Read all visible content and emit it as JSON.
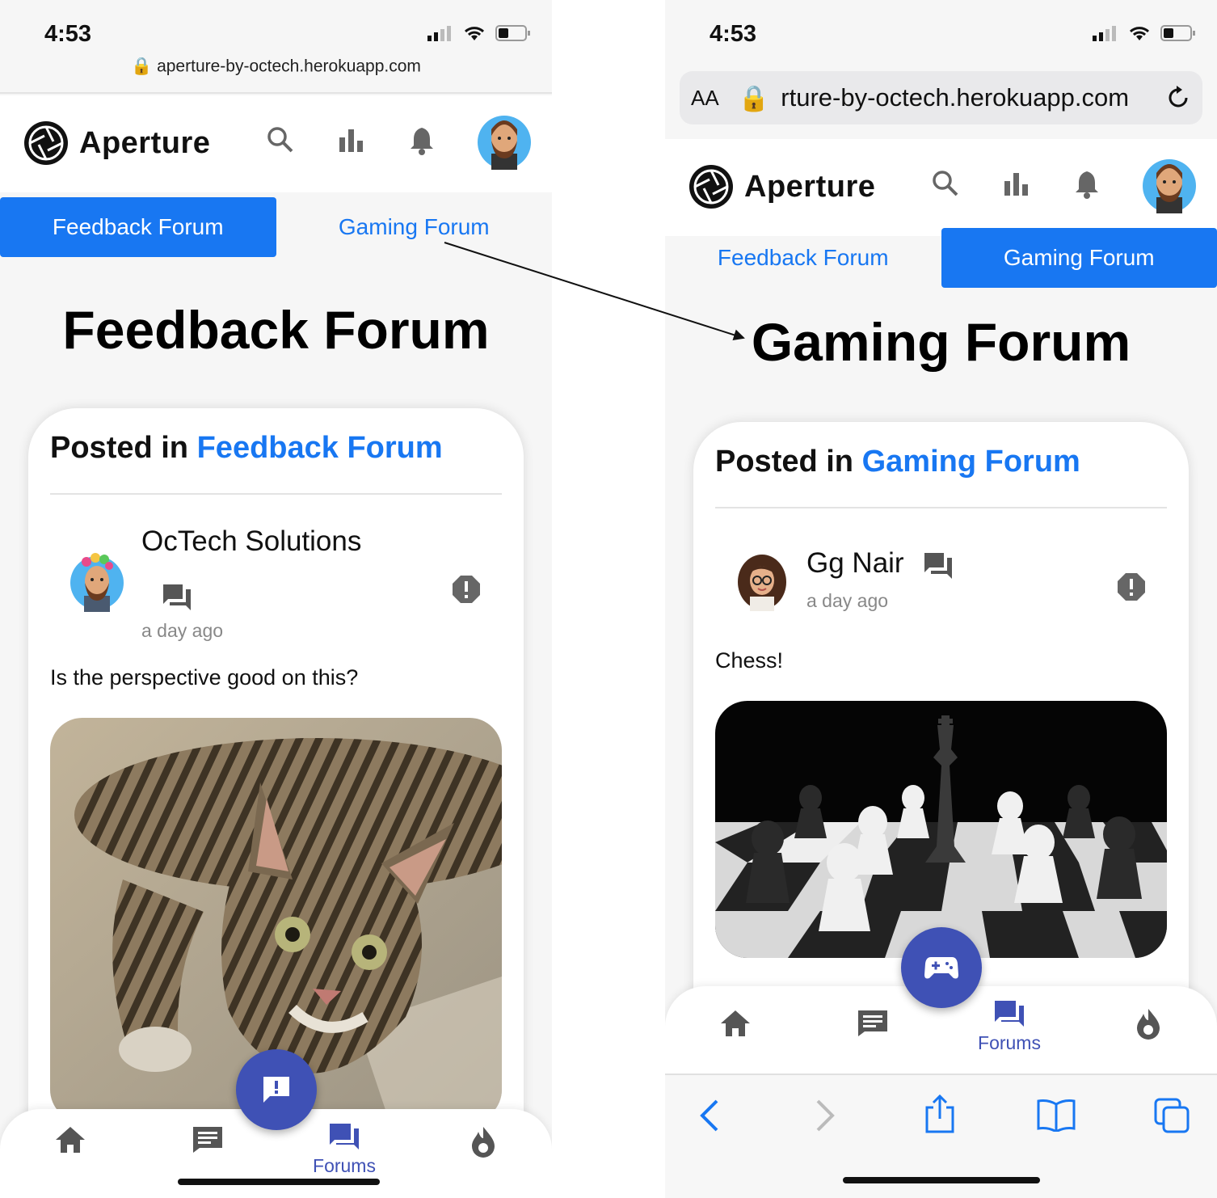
{
  "left": {
    "status_time": "4:53",
    "url": "aperture-by-octech.herokuapp.com",
    "brand": "Aperture",
    "tabs": [
      "Feedback Forum",
      "Gaming Forum"
    ],
    "active_tab": "Feedback Forum",
    "page_title": "Feedback Forum",
    "posted_prefix": "Posted in",
    "posted_forum": "Feedback Forum",
    "author": "OcTech Solutions",
    "time_ago": "a day ago",
    "post_text": "Is the perspective good on this?",
    "nav_label": "Forums"
  },
  "right": {
    "status_time": "4:53",
    "url_aa": "AA",
    "url": "rture-by-octech.herokuapp.com",
    "brand": "Aperture",
    "tabs": [
      "Feedback Forum",
      "Gaming Forum"
    ],
    "active_tab": "Gaming Forum",
    "page_title": "Gaming Forum",
    "posted_prefix": "Posted in",
    "posted_forum": "Gaming Forum",
    "author": "Gg Nair",
    "time_ago": "a day ago",
    "post_text": "Chess!",
    "nav_label": "Forums"
  },
  "colors": {
    "accent_blue": "#1877f2",
    "indigo": "#3f51b5"
  }
}
